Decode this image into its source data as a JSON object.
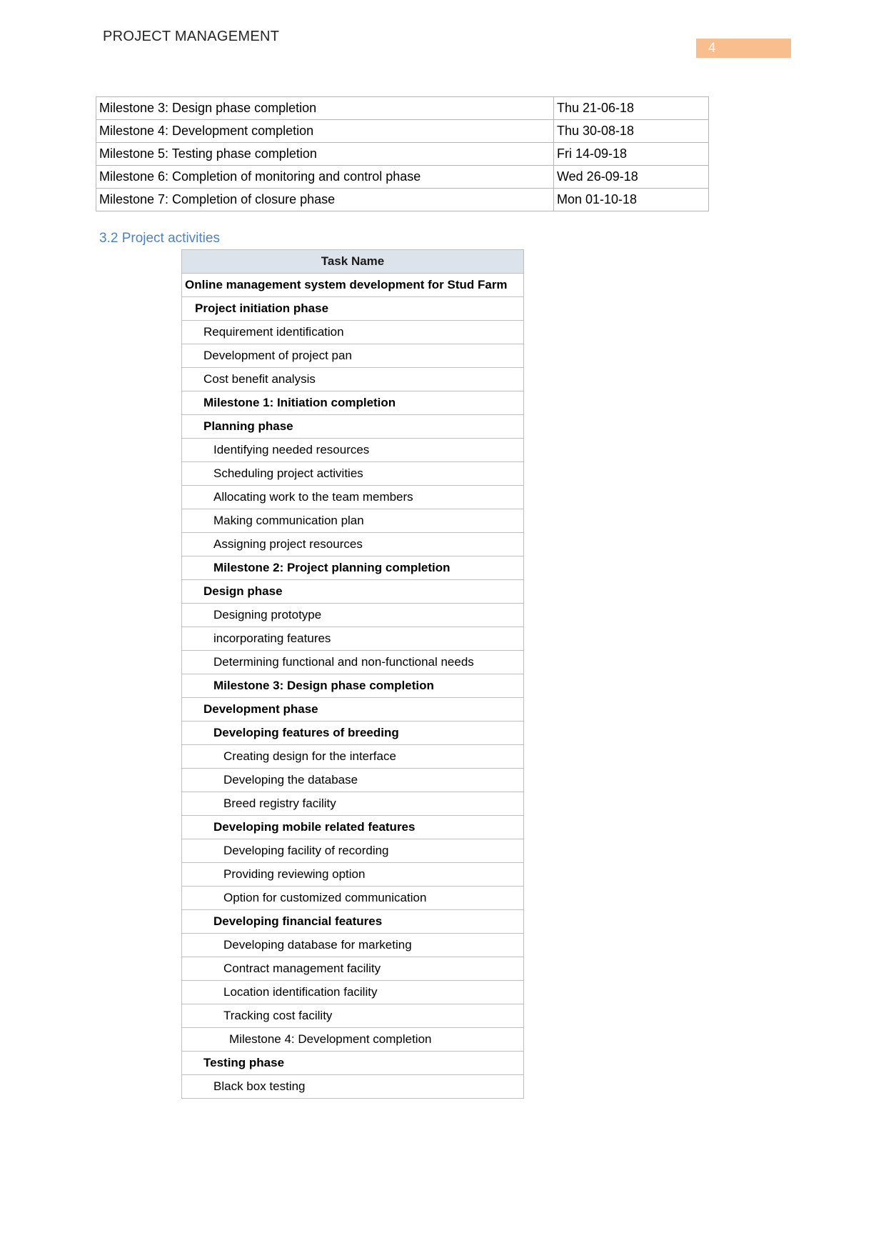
{
  "header": {
    "doc_title": "PROJECT MANAGEMENT",
    "page_number": "4",
    "badge_color": "#f8be8d"
  },
  "milestone_table": {
    "rows": [
      {
        "name": "Milestone 3: Design phase completion",
        "date": "Thu 21-06-18"
      },
      {
        "name": "Milestone 4: Development completion",
        "date": "Thu 30-08-18"
      },
      {
        "name": "Milestone 5: Testing phase completion",
        "date": "Fri 14-09-18"
      },
      {
        "name": "Milestone 6: Completion of monitoring and control phase",
        "date": "Wed 26-09-18"
      },
      {
        "name": "Milestone 7: Completion of closure phase",
        "date": "Mon 01-10-18"
      }
    ]
  },
  "section": {
    "heading": "3.2 Project activities",
    "heading_color": "#4f81bd"
  },
  "task_table": {
    "header": "Task Name",
    "header_bg": "#dde3ea",
    "rows": [
      {
        "label": "Online management system development for Stud Farm",
        "level": 0,
        "bold": true
      },
      {
        "label": "Project initiation phase",
        "level": 1,
        "bold": true
      },
      {
        "label": "Requirement identification",
        "level": 2,
        "bold": false
      },
      {
        "label": "Development of project pan",
        "level": 2,
        "bold": false
      },
      {
        "label": "Cost benefit analysis",
        "level": 2,
        "bold": false
      },
      {
        "label": "Milestone 1: Initiation completion",
        "level": 2,
        "bold": true
      },
      {
        "label": "Planning phase",
        "level": 2,
        "bold": true
      },
      {
        "label": "Identifying needed resources",
        "level": 3,
        "bold": false
      },
      {
        "label": "Scheduling project activities",
        "level": 3,
        "bold": false
      },
      {
        "label": "Allocating work to the team members",
        "level": 3,
        "bold": false
      },
      {
        "label": "Making communication plan",
        "level": 3,
        "bold": false
      },
      {
        "label": "Assigning project resources",
        "level": 3,
        "bold": false
      },
      {
        "label": "Milestone 2: Project planning completion",
        "level": 3,
        "bold": true
      },
      {
        "label": "Design phase",
        "level": 2,
        "bold": true
      },
      {
        "label": "Designing prototype",
        "level": 3,
        "bold": false
      },
      {
        "label": "incorporating features",
        "level": 3,
        "bold": false
      },
      {
        "label": "Determining functional and non-functional needs",
        "level": 3,
        "bold": false
      },
      {
        "label": "Milestone 3: Design phase completion",
        "level": 3,
        "bold": true
      },
      {
        "label": "Development phase",
        "level": 2,
        "bold": true
      },
      {
        "label": "Developing features of breeding",
        "level": 3,
        "bold": true
      },
      {
        "label": "Creating design for the interface",
        "level": 4,
        "bold": false
      },
      {
        "label": "Developing the database",
        "level": 4,
        "bold": false
      },
      {
        "label": "Breed registry facility",
        "level": 4,
        "bold": false
      },
      {
        "label": "Developing mobile related features",
        "level": 3,
        "bold": true
      },
      {
        "label": "Developing facility of recording",
        "level": 4,
        "bold": false
      },
      {
        "label": "Providing reviewing option",
        "level": 4,
        "bold": false
      },
      {
        "label": "Option for customized communication",
        "level": 4,
        "bold": false
      },
      {
        "label": "Developing financial features",
        "level": 3,
        "bold": true
      },
      {
        "label": "Developing database for marketing",
        "level": 4,
        "bold": false
      },
      {
        "label": "Contract management facility",
        "level": 4,
        "bold": false
      },
      {
        "label": "Location identification facility",
        "level": 4,
        "bold": false
      },
      {
        "label": "Tracking cost facility",
        "level": 4,
        "bold": false
      },
      {
        "label": "Milestone 4: Development completion",
        "level": 5,
        "bold": false
      },
      {
        "label": "Testing phase",
        "level": 2,
        "bold": true
      },
      {
        "label": "Black box testing",
        "level": 3,
        "bold": false
      }
    ]
  }
}
